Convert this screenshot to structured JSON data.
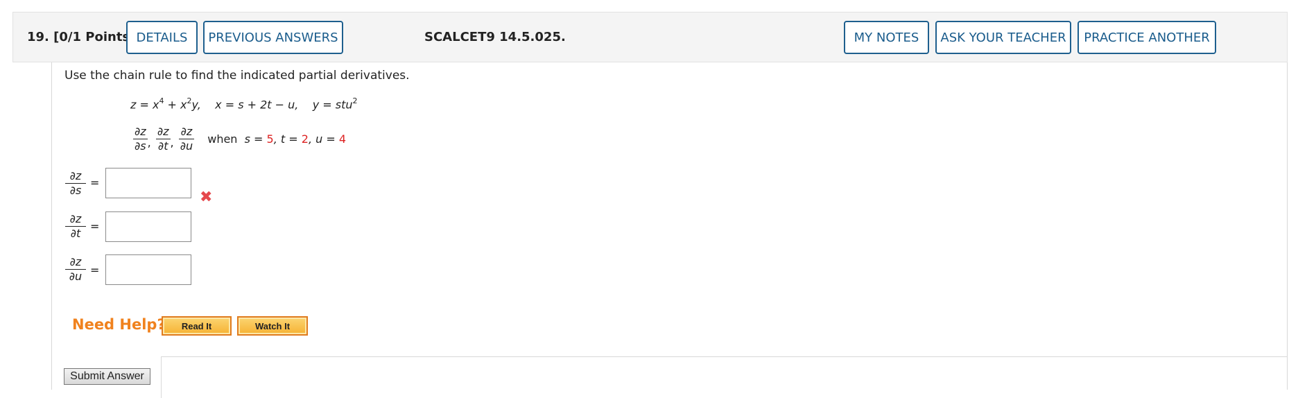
{
  "header": {
    "question_label": "19.  [0/1 Points]",
    "details_label": "DETAILS",
    "previous_answers_label": "PREVIOUS ANSWERS",
    "problem_code": "SCALCET9 14.5.025.",
    "my_notes_label": "MY NOTES",
    "ask_teacher_label": "ASK YOUR TEACHER",
    "practice_another_label": "PRACTICE ANOTHER"
  },
  "problem": {
    "instructions": "Use the chain rule to find the indicated partial derivatives.",
    "eq_z": "z = x",
    "eq_z_exp1": "4",
    "eq_z_mid": " + x",
    "eq_z_exp2": "2",
    "eq_z_end": "y,",
    "eq_x": "x = s + 2t − u,",
    "eq_y": "y = stu",
    "eq_y_exp": "2",
    "partials": [
      {
        "num": "∂z",
        "den": "∂s"
      },
      {
        "num": "∂z",
        "den": "∂t"
      },
      {
        "num": "∂z",
        "den": "∂u"
      }
    ],
    "when_label": "when",
    "cond_s_var": "s = ",
    "cond_s_val": "5",
    "cond_t_var": "t = ",
    "cond_t_val": "2",
    "cond_u_var": "u = ",
    "cond_u_val": "4"
  },
  "answers": [
    {
      "num": "∂z",
      "den": "∂s",
      "eq": "=",
      "value": "",
      "status": "incorrect"
    },
    {
      "num": "∂z",
      "den": "∂t",
      "eq": "=",
      "value": ""
    },
    {
      "num": "∂z",
      "den": "∂u",
      "eq": "=",
      "value": ""
    }
  ],
  "icons": {
    "incorrect": "✖"
  },
  "help": {
    "label": "Need Help?",
    "read_it_label": "Read It",
    "watch_it_label": "Watch It"
  },
  "submit_label": "Submit Answer",
  "colors": {
    "accent": "#1a5c8c",
    "given_value": "#dd2222",
    "help_orange": "#f0821e",
    "incorrect": "#e5484d"
  }
}
